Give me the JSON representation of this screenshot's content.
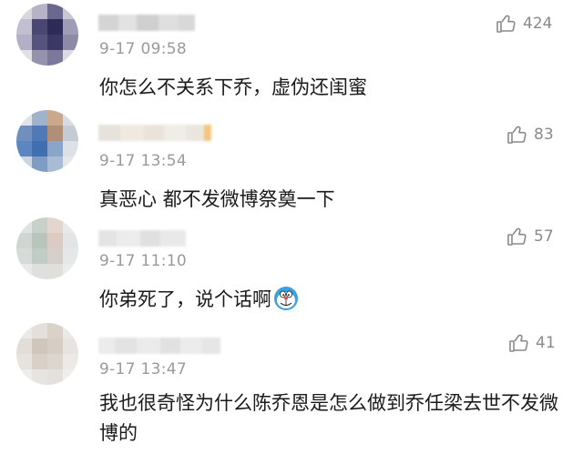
{
  "comments": [
    {
      "time": "9-17 09:58",
      "text": "你怎么不关系下乔，虚伪还闺蜜",
      "likes": "424",
      "avatar_colors": [
        "#d9d6df",
        "#b7b2c6",
        "#6b6890",
        "#c9c7d3",
        "#c2bfd2",
        "#4a4775",
        "#2e2b57",
        "#9f9cb8",
        "#b3afc7",
        "#56537e",
        "#3b3866",
        "#8d8aa8",
        "#e2e0e7",
        "#9592ad",
        "#7b789b",
        "#dcdae3"
      ],
      "like_icon": "thumbs-up-icon"
    },
    {
      "time": "9-17 13:54",
      "text": "真恶心 都不发微博祭奠一下",
      "likes": "83",
      "avatar_colors": [
        "#e0e4ea",
        "#9fb3cc",
        "#c9a98e",
        "#d8dbe1",
        "#6f8fbf",
        "#4f79b8",
        "#b08f79",
        "#c5cbd3",
        "#5c86c2",
        "#3f6fb0",
        "#8aa5c9",
        "#dde1e7",
        "#cfd5de",
        "#7f9cc4",
        "#a9bcd5",
        "#e4e6ea"
      ],
      "like_icon": "thumbs-up-icon"
    },
    {
      "time": "9-17 11:10",
      "text": "你弟死了，说个话啊",
      "likes": "57",
      "avatar_colors": [
        "#dfe3e4",
        "#c8d1c9",
        "#e3d6cf",
        "#e7e9ea",
        "#cfd6d2",
        "#b9c4bc",
        "#dccbc2",
        "#e2e4e5",
        "#d7dbd8",
        "#c2ccc6",
        "#d5cfca",
        "#e6e7e8",
        "#e8e9e9",
        "#dde0de",
        "#e1dfdd",
        "#ebecec"
      ],
      "like_icon": "thumbs-up-icon",
      "emoji_icon": "doraemon-emoji-icon"
    },
    {
      "time": "9-17 13:47",
      "text": "我也很奇怪为什么陈乔恩是怎么做到乔任梁去世不发微博的",
      "likes": "41",
      "avatar_colors": [
        "#ece9e6",
        "#e4dfda",
        "#d9d2ca",
        "#ebe8e5",
        "#e2ddd7",
        "#cfc6bc",
        "#d6cec5",
        "#e7e3df",
        "#e6e2de",
        "#d9d1c8",
        "#ddd6ce",
        "#ece9e6",
        "#efedeb",
        "#e8e5e1",
        "#e4e0dc",
        "#f0eeec"
      ],
      "like_icon": "thumbs-up-icon"
    }
  ]
}
